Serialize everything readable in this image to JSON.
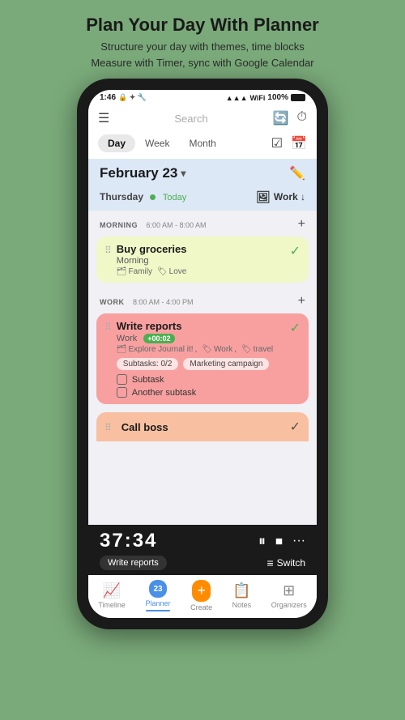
{
  "header": {
    "title": "Plan Your Day With Planner",
    "subtitle_line1": "Structure your day with themes, time blocks",
    "subtitle_line2": "Measure with Timer, sync with Google Calendar"
  },
  "status_bar": {
    "time": "1:46",
    "battery": "100%",
    "icons": "signal wifi"
  },
  "top_nav": {
    "search_placeholder": "Search"
  },
  "tabs": {
    "items": [
      "Day",
      "Week",
      "Month"
    ],
    "active": "Day"
  },
  "date_header": {
    "date": "February 23",
    "chevron": "▾",
    "day": "Thursday",
    "today_label": "Today",
    "work_label": "Work ↓"
  },
  "morning_block": {
    "title": "MORNING",
    "time_range": "6:00 AM - 8:00 AM",
    "task": {
      "name": "Buy groceries",
      "sub_label": "Morning",
      "tags": [
        "Family",
        "Love"
      ]
    }
  },
  "work_block": {
    "title": "WORK",
    "time_range": "8:00 AM - 4:00 PM",
    "task": {
      "name": "Write reports",
      "sub_label": "Work",
      "timer_badge": "+00:02",
      "tags": [
        "Explore Journal it!",
        "Work",
        "travel"
      ],
      "subtasks_label": "Subtasks: 0/2",
      "marketing_label": "Marketing campaign",
      "subtask1": "Subtask",
      "subtask2": "Another subtask"
    },
    "task2": {
      "name": "Call boss"
    }
  },
  "timer_bar": {
    "time": "37:34",
    "label": "Write reports",
    "switch_label": "Switch"
  },
  "bottom_nav": {
    "items": [
      {
        "label": "Timeline",
        "icon": "📈"
      },
      {
        "label": "Planner",
        "icon": "23",
        "active": true
      },
      {
        "label": "Create",
        "icon": "+"
      },
      {
        "label": "Notes",
        "icon": "📋"
      },
      {
        "label": "Organizers",
        "icon": "⊞"
      }
    ]
  }
}
